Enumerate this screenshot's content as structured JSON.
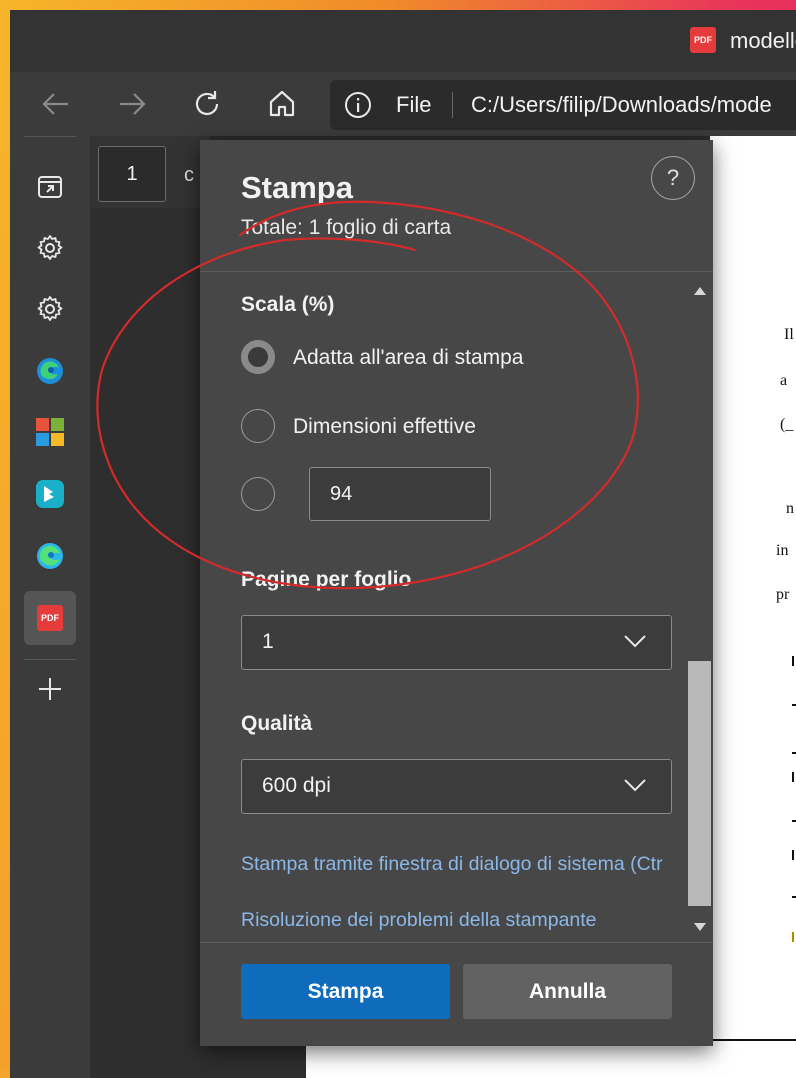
{
  "window": {
    "title": "modello",
    "title_icon": "PDF"
  },
  "toolbar": {
    "address_prefix": "File",
    "url": "C:/Users/filip/Downloads/mode"
  },
  "viewer": {
    "page_number": "1",
    "page_of": "c",
    "paper_snippets": [
      "Il",
      "a",
      "(_",
      "n",
      "in",
      "pr"
    ]
  },
  "dialog": {
    "title": "Stampa",
    "total": "Totale: 1 foglio di carta",
    "help": "?",
    "scale": {
      "title": "Scala (%)",
      "options": [
        {
          "label": "Adatta all'area di stampa",
          "checked": true
        },
        {
          "label": "Dimensioni effettive",
          "checked": false
        },
        {
          "label": "",
          "checked": false
        }
      ],
      "custom_value": "94"
    },
    "pages_per_sheet": {
      "title": "Pagine per foglio",
      "value": "1"
    },
    "quality": {
      "title": "Qualità",
      "value": "600 dpi"
    },
    "links": {
      "system_dialog": "Stampa tramite finestra di dialogo di sistema (Ctr",
      "troubleshoot": "Risoluzione dei problemi della stampante"
    },
    "buttons": {
      "print": "Stampa",
      "cancel": "Annulla"
    }
  },
  "colors": {
    "accent": "#0f6cbd",
    "link": "#8bb8e8",
    "annotation": "#d42a2a"
  }
}
